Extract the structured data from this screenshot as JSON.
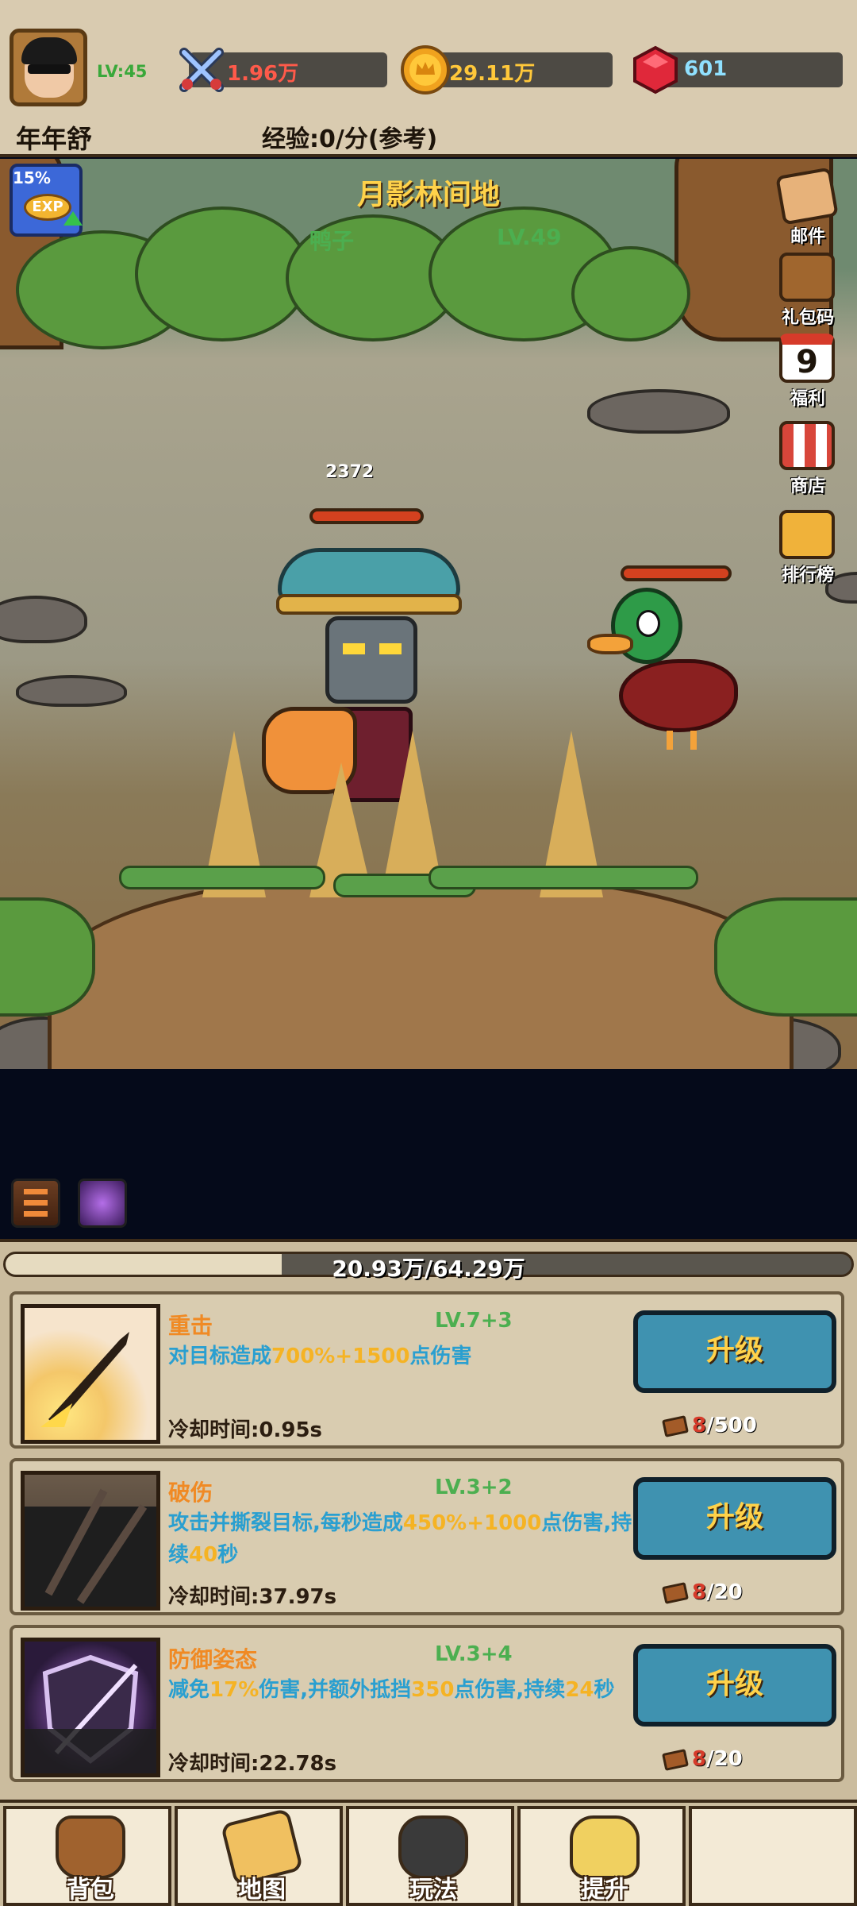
{
  "player": {
    "level": "LV:45",
    "name": "年年舒",
    "exp_rate": "经验:0/分(参考)"
  },
  "resources": {
    "power": "1.96万",
    "gold": "29.11万",
    "gems": "601"
  },
  "scene": {
    "map_name": "月影林间地",
    "enemy_name": "鸭子",
    "enemy_level": "LV.49",
    "damage_number": "2372",
    "exp_boost_percent": "15%",
    "exp_boost_label": "EXP"
  },
  "side_menu": [
    {
      "label": "邮件",
      "icon": "mail-icon",
      "color": "#e7b27a"
    },
    {
      "label": "礼包码",
      "icon": "treasure-chest-icon",
      "color": "#a0662e"
    },
    {
      "label": "福利",
      "icon": "calendar-icon",
      "color": "#ffffff",
      "badge": "9"
    },
    {
      "label": "商店",
      "icon": "shop-icon",
      "color": "#d8463a"
    },
    {
      "label": "排行榜",
      "icon": "podium-icon",
      "color": "#f0b23a"
    }
  ],
  "stage_progress": {
    "text": "20.93万/64.29万",
    "fraction": 0.326
  },
  "skills": [
    {
      "name": "重击",
      "level": "LV.7+3",
      "desc_parts": [
        "对目标造成",
        "700%+1500",
        "点伤害"
      ],
      "cooldown": "冷却时间:0.95s",
      "button": "升级",
      "cost_have": "8",
      "cost_need": "/500"
    },
    {
      "name": "破伤",
      "level": "LV.3+2",
      "desc_parts": [
        "攻击并撕裂目标,每秒造成",
        "450%+1000",
        "点伤害,持续",
        "40",
        "秒"
      ],
      "cooldown": "冷却时间:37.97s",
      "button": "升级",
      "cost_have": "8",
      "cost_need": "/20"
    },
    {
      "name": "防御姿态",
      "level": "LV.3+4",
      "desc_parts": [
        "减免",
        "17%",
        "伤害,并额外抵挡",
        "350",
        "点伤害,持续",
        "24",
        "秒"
      ],
      "cooldown": "冷却时间:22.78s",
      "button": "升级",
      "cost_have": "8",
      "cost_need": "/20"
    }
  ],
  "bottom_nav": [
    {
      "label": "背包",
      "icon": "bag-icon"
    },
    {
      "label": "地图",
      "icon": "map-icon"
    },
    {
      "label": "玩法",
      "icon": "gamepad-icon"
    },
    {
      "label": "提升",
      "icon": "fist-icon"
    },
    {
      "label": "",
      "icon": ""
    }
  ],
  "colors": {
    "accent_gold": "#ffd24a",
    "skill_blue": "#2a9fd0",
    "skill_highlight": "#f5b324",
    "level_green": "#4caf50",
    "button_blue": "#3f92b0"
  }
}
